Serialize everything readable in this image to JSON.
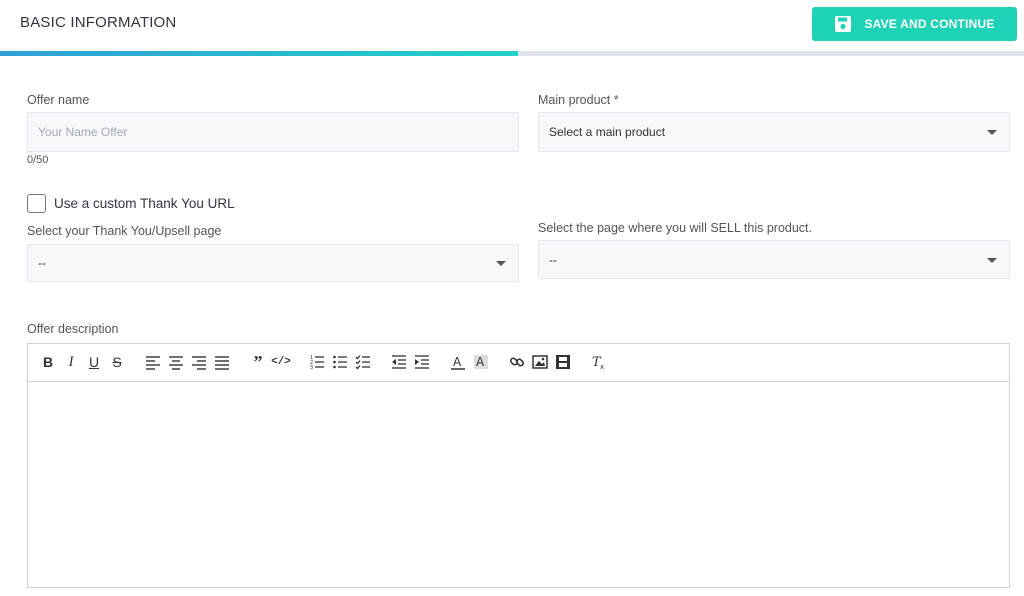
{
  "header": {
    "title": "BASIC INFORMATION",
    "save_label": "SAVE AND CONTINUE",
    "progress_percent": 50.6
  },
  "offer_name": {
    "label": "Offer name",
    "placeholder": "Your Name Offer",
    "value": "",
    "counter": "0/50"
  },
  "main_product": {
    "label": "Main product *",
    "selected": "Select a main product"
  },
  "custom_thank_you": {
    "label": "Use a custom Thank You URL",
    "checked": false
  },
  "thank_you_page": {
    "label": "Select your Thank You/Upsell page",
    "selected": "--"
  },
  "sell_page": {
    "label": "Select the page where you will SELL this product.",
    "selected": "--"
  },
  "description": {
    "label": "Offer description",
    "toolbar": [
      "bold-icon",
      "italic-icon",
      "underline-icon",
      "strikethrough-icon",
      "align-left-icon",
      "align-center-icon",
      "align-right-icon",
      "align-justify-icon",
      "blockquote-icon",
      "code-icon",
      "ordered-list-icon",
      "bullet-list-icon",
      "checklist-icon",
      "outdent-icon",
      "indent-icon",
      "font-color-icon",
      "background-color-icon",
      "link-icon",
      "image-icon",
      "video-icon",
      "clear-format-icon"
    ]
  },
  "colors": {
    "accent": "#1ed3b5",
    "progress_start": "#2f9fd6",
    "progress_end": "#21d1c8"
  }
}
